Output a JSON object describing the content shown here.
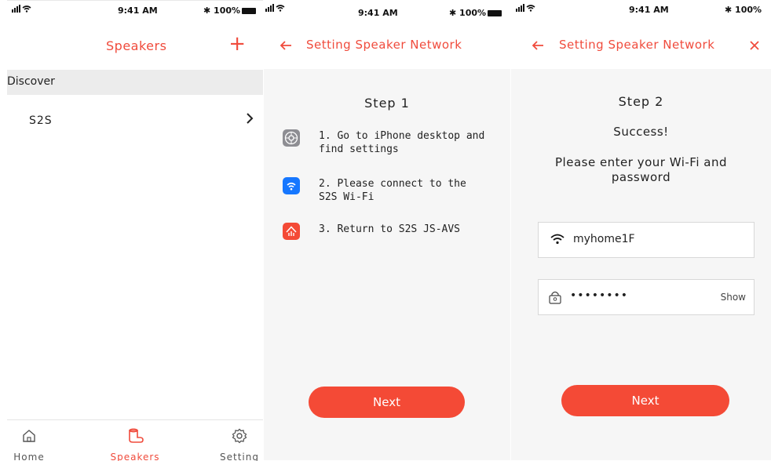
{
  "status": {
    "time": "9:41 AM",
    "battery": "100%"
  },
  "screen1": {
    "title": "Speakers",
    "add_label": "+",
    "section_header": "Discover",
    "device_name": "S2S",
    "tabs": [
      {
        "label": "Home",
        "icon": "home-icon"
      },
      {
        "label": "Speakers",
        "icon": "speaker-icon"
      },
      {
        "label": "Setting",
        "icon": "gear-icon"
      }
    ],
    "active_tab": "Speakers"
  },
  "screen2": {
    "title": "Setting Speaker Network",
    "step": "Step 1",
    "instructions": [
      {
        "line1": "1. Go to iPhone desktop and",
        "line2": "find settings",
        "icon": "settings-app-icon"
      },
      {
        "line1": "2. Please connect to the",
        "line2": "S2S Wi-Fi",
        "icon": "wifi-app-icon"
      },
      {
        "line1": "3. Return to S2S JS-AVS",
        "line2": "",
        "icon": "s2s-app-icon"
      }
    ],
    "next_label": "Next"
  },
  "screen3": {
    "title": "Setting Speaker Network",
    "step": "Step 2",
    "success": "Success!",
    "prompt_line1": "Please enter your Wi-Fi and",
    "prompt_line2": "password",
    "wifi_value": "myhome1F",
    "password_value": "••••••••",
    "show_label": "Show",
    "next_label": "Next"
  },
  "colors": {
    "accent": "#f04b3c",
    "button": "#f44a36",
    "wifi_icon_bg": "#1677ff",
    "settings_icon_bg": "#8e8e93"
  }
}
